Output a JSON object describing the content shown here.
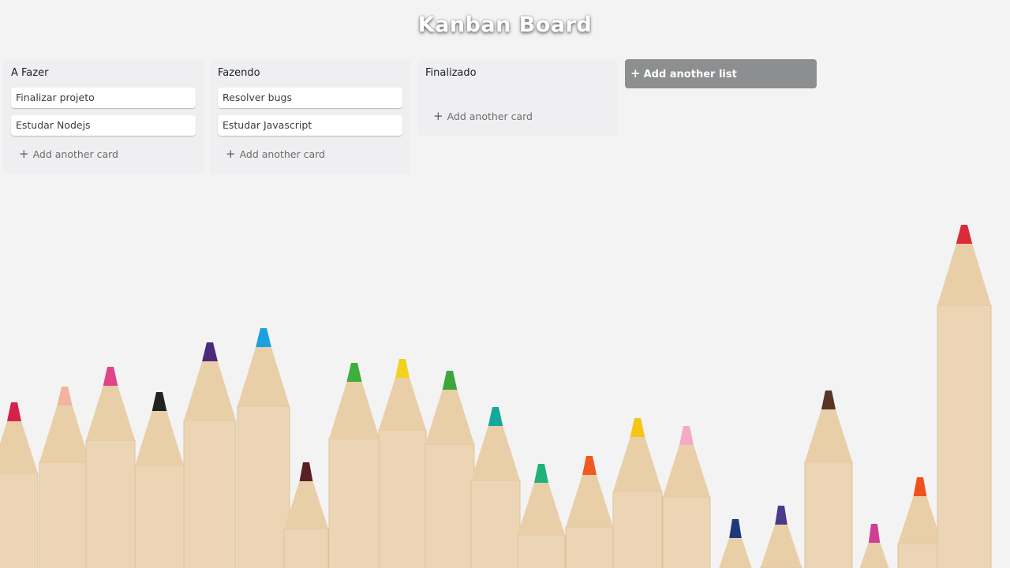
{
  "header": {
    "title": "Kanban Board"
  },
  "lists": [
    {
      "title": "A Fazer",
      "cards": [
        "Finalizar projeto",
        "Estudar Nodejs"
      ],
      "add_card_label": "Add another card"
    },
    {
      "title": "Fazendo",
      "cards": [
        "Resolver bugs",
        "Estudar Javascript"
      ],
      "add_card_label": "Add another card"
    },
    {
      "title": "Finalizado",
      "cards": [],
      "add_card_label": "Add another card"
    }
  ],
  "add_list": {
    "label": "Add another list",
    "icon": "plus-icon"
  },
  "icons": {
    "add_card": "plus-icon"
  },
  "colors": {
    "background": "#f3f3f4",
    "list_bg": "#eeeef0",
    "card_bg": "#ffffff",
    "add_list_bg": "#8d8e8f",
    "title_text": "#ffffff"
  },
  "background_pencil_colors": [
    "#d6214a",
    "#f2b4a0",
    "#e0438a",
    "#222222",
    "#4b2c7a",
    "#1ba1e0",
    "#5a1f24",
    "#3fae3a",
    "#f2d21e",
    "#3ca63c",
    "#14a89a",
    "#22b07a",
    "#ef5a1e",
    "#f5c518",
    "#f4a9c6",
    "#1f3a7a",
    "#4a3a8a",
    "#5a3424",
    "#d03f93",
    "#f0501e",
    "#dd2a3b"
  ]
}
